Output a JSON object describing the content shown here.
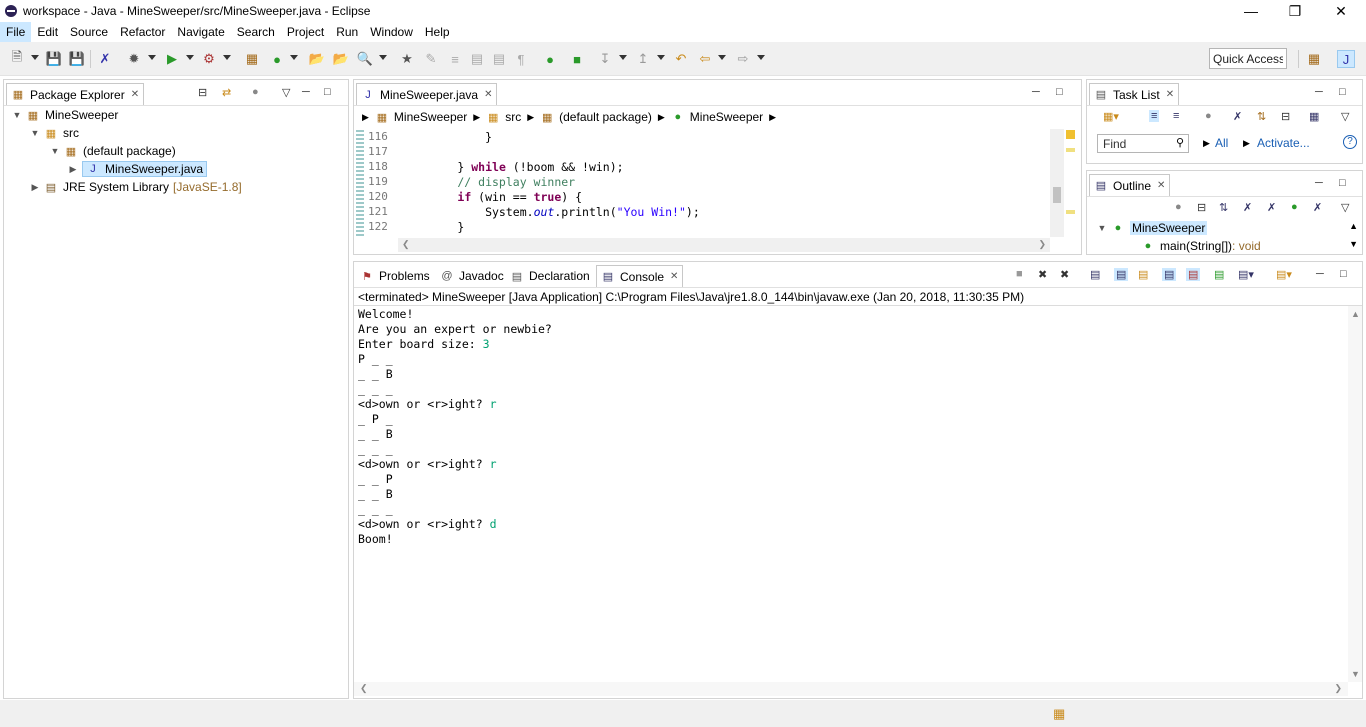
{
  "window": {
    "title": "workspace - Java - MineSweeper/src/MineSweeper.java - Eclipse"
  },
  "menu": [
    "File",
    "Edit",
    "Source",
    "Refactor",
    "Navigate",
    "Search",
    "Project",
    "Run",
    "Window",
    "Help"
  ],
  "quick_access": "Quick Access",
  "package_explorer": {
    "tab": "Package Explorer",
    "tree": {
      "project": "MineSweeper",
      "src": "src",
      "package": "(default package)",
      "file": "MineSweeper.java",
      "lib": "JRE System Library",
      "lib_suffix": "[JavaSE-1.8]"
    }
  },
  "editor": {
    "tab": "MineSweeper.java",
    "breadcrumb": [
      "MineSweeper",
      "src",
      "(default package)",
      "MineSweeper"
    ],
    "lines": [
      {
        "n": "116",
        "parts": [
          {
            "t": "            }",
            "c": ""
          }
        ]
      },
      {
        "n": "117",
        "parts": []
      },
      {
        "n": "118",
        "parts": [
          {
            "t": "        } ",
            "c": ""
          },
          {
            "t": "while",
            "c": "kw"
          },
          {
            "t": " (!boom && !win);",
            "c": ""
          }
        ]
      },
      {
        "n": "119",
        "parts": [
          {
            "t": "        // display winner",
            "c": "cm"
          }
        ]
      },
      {
        "n": "120",
        "parts": [
          {
            "t": "        ",
            "c": ""
          },
          {
            "t": "if",
            "c": "kw"
          },
          {
            "t": " (win == ",
            "c": ""
          },
          {
            "t": "true",
            "c": "kw"
          },
          {
            "t": ") {",
            "c": ""
          }
        ]
      },
      {
        "n": "121",
        "parts": [
          {
            "t": "            System.",
            "c": ""
          },
          {
            "t": "out",
            "c": "fld"
          },
          {
            "t": ".println(",
            "c": ""
          },
          {
            "t": "\"You Win!\"",
            "c": "str"
          },
          {
            "t": ");",
            "c": ""
          }
        ]
      },
      {
        "n": "122",
        "parts": [
          {
            "t": "        }",
            "c": ""
          }
        ]
      }
    ]
  },
  "task_list": {
    "tab": "Task List",
    "find_placeholder": "Find",
    "all": "All",
    "activate": "Activate..."
  },
  "outline": {
    "tab": "Outline",
    "class": "MineSweeper",
    "method": "main(String[])",
    "method_type": " : void"
  },
  "bottom_tabs": {
    "problems": "Problems",
    "javadoc": "Javadoc",
    "declaration": "Declaration",
    "console": "Console"
  },
  "console": {
    "header": "<terminated> MineSweeper [Java Application] C:\\Program Files\\Java\\jre1.8.0_144\\bin\\javaw.exe (Jan 20, 2018, 11:30:35 PM)",
    "lines": [
      {
        "t": "Welcome!",
        "in": ""
      },
      {
        "t": "Are you an expert or newbie?",
        "in": ""
      },
      {
        "t": "Enter board size: ",
        "in": "3"
      },
      {
        "t": "P _ _",
        "in": ""
      },
      {
        "t": "_ _ B",
        "in": ""
      },
      {
        "t": "_ _ _",
        "in": ""
      },
      {
        "t": "<d>own or <r>ight? ",
        "in": "r"
      },
      {
        "t": "_ P _",
        "in": ""
      },
      {
        "t": "_ _ B",
        "in": ""
      },
      {
        "t": "_ _ _",
        "in": ""
      },
      {
        "t": "<d>own or <r>ight? ",
        "in": "r"
      },
      {
        "t": "_ _ P",
        "in": ""
      },
      {
        "t": "_ _ B",
        "in": ""
      },
      {
        "t": "_ _ _",
        "in": ""
      },
      {
        "t": "<d>own or <r>ight? ",
        "in": "d"
      },
      {
        "t": "Boom!",
        "in": ""
      }
    ]
  },
  "colors": {
    "keyword": "#7f0055",
    "comment": "#3f7f5f",
    "string": "#2a00ff",
    "input": "#00a070",
    "selection": "#cce8ff"
  }
}
